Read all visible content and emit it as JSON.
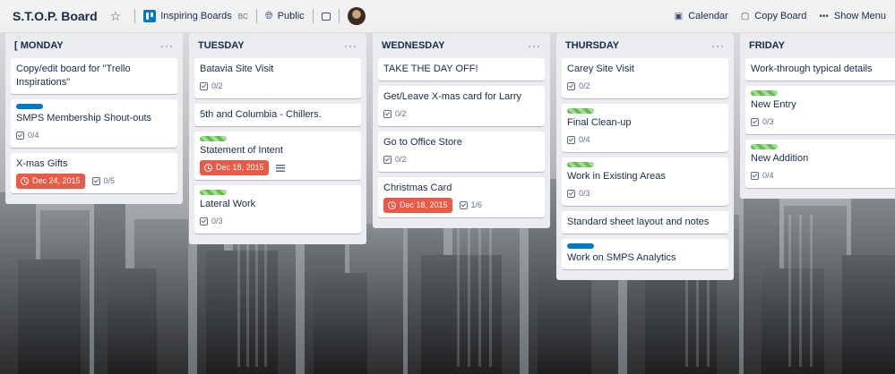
{
  "board": {
    "title": "S.T.O.P. Board",
    "team_name": "Inspiring Boards",
    "team_badge": "BC",
    "visibility": "Public"
  },
  "actions": {
    "calendar": "Calendar",
    "copy_board": "Copy Board",
    "show_menu": "Show Menu"
  },
  "colors": {
    "green_label": "#61bd4f",
    "blue_label": "#0079bf",
    "due_red": "#eb5a46",
    "list_bg": "#ebecf0"
  },
  "lists": [
    {
      "title": "[ MONDAY",
      "cards": [
        {
          "title": "Copy/edit board for \"Trello Inspirations\""
        },
        {
          "label": "blue",
          "title": "SMPS Membership Shout-outs",
          "checklist": "0/4"
        },
        {
          "title": "X-mas Gifts",
          "due": "Dec 24, 2015",
          "checklist": "0/5"
        }
      ]
    },
    {
      "title": "TUESDAY",
      "cards": [
        {
          "title": "Batavia Site Visit",
          "checklist": "0/2"
        },
        {
          "title": "5th and Columbia - Chillers."
        },
        {
          "label": "green",
          "title": "Statement of Intent",
          "due": "Dec 18, 2015",
          "description": true
        },
        {
          "label": "green",
          "title": "Lateral Work",
          "checklist": "0/3"
        }
      ]
    },
    {
      "title": "WEDNESDAY",
      "cards": [
        {
          "title": "TAKE THE DAY OFF!"
        },
        {
          "title": "Get/Leave X-mas card for Larry",
          "checklist": "0/2"
        },
        {
          "title": "Go to Office Store",
          "checklist": "0/2"
        },
        {
          "title": "Christmas Card",
          "due": "Dec 18, 2015",
          "checklist": "1/6"
        }
      ]
    },
    {
      "title": "THURSDAY",
      "cards": [
        {
          "title": "Carey Site Visit",
          "checklist": "0/2"
        },
        {
          "label": "green",
          "title": "Final Clean-up",
          "checklist": "0/4"
        },
        {
          "label": "green",
          "title": "Work in Existing Areas",
          "checklist": "0/3"
        },
        {
          "title": "Standard sheet layout and notes"
        },
        {
          "label": "blue",
          "title": "Work on SMPS Analytics"
        }
      ]
    },
    {
      "title": "FRIDAY",
      "cards": [
        {
          "title": "Work-through typical details"
        },
        {
          "label": "green",
          "title": "New Entry",
          "checklist": "0/3"
        },
        {
          "label": "green",
          "title": "New Addition",
          "checklist": "0/4"
        }
      ]
    }
  ]
}
